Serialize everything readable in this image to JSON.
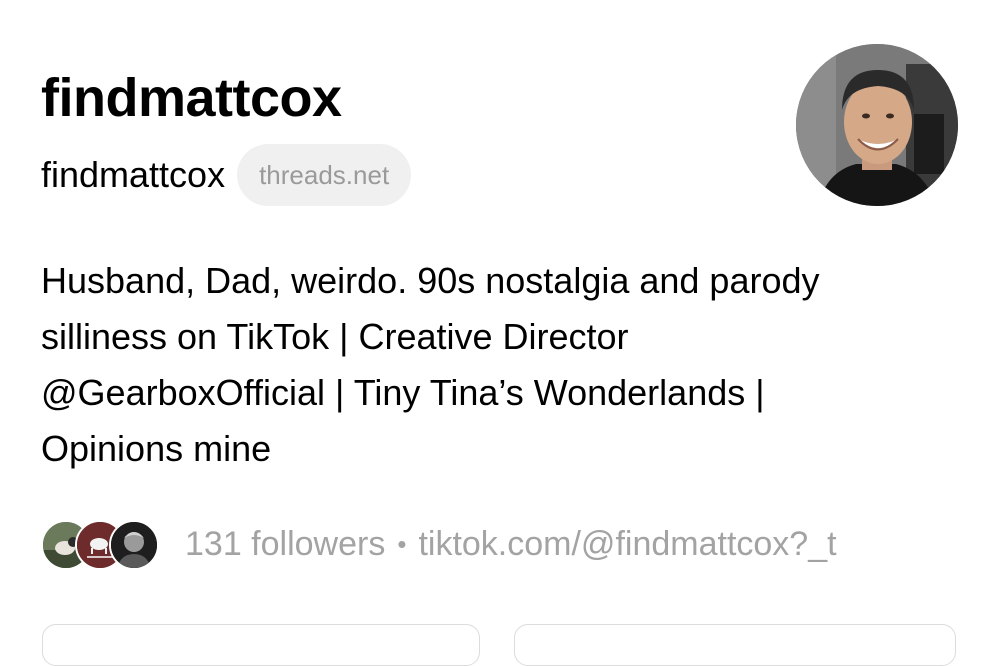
{
  "profile": {
    "display_name": "findmattcox",
    "username": "findmattcox",
    "domain_badge": "threads.net",
    "avatar_icon": "profile-photo",
    "bio_lines": [
      "Husband, Dad, weirdo. 90s nostalgia and parody",
      "silliness on TikTok | Creative Director",
      "@GearboxOfficial | Tiny Tina’s Wonderlands |",
      "Opinions mine"
    ],
    "followers_text": "131 followers",
    "separator": "•",
    "link_text": "tiktok.com/@findmattcox?_t"
  },
  "colors": {
    "text_primary": "#000000",
    "text_secondary": "#a3a3a3",
    "pill_background": "#f0f0f0",
    "border": "#dcdcdc"
  }
}
